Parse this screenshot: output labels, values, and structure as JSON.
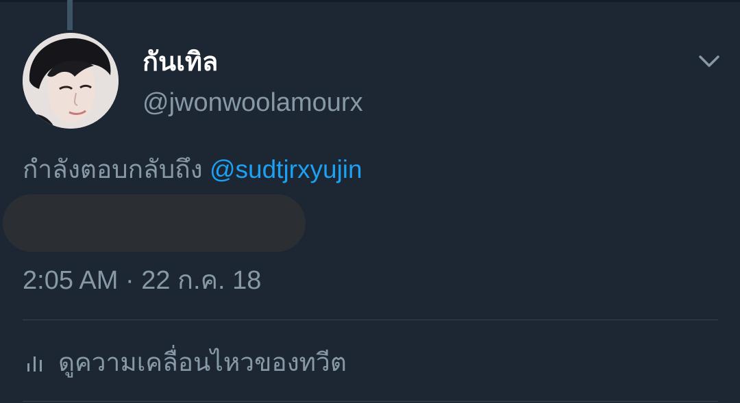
{
  "tweet": {
    "display_name": "กันเทิล",
    "handle": "@jwonwoolamourx",
    "reply_prefix": "กำลังตอบกลับถึง",
    "reply_mention": "@sudtjrxyujin",
    "timestamp": "2:05 AM · 22 ก.ค. 18"
  },
  "actions": {
    "view_activity_label": "ดูความเคลื่อนไหวของทวีต"
  },
  "icons": {
    "more": "chevron-down-icon",
    "activity": "bar-chart-icon"
  },
  "colors": {
    "background": "#1c2733",
    "text_primary": "#ffffff",
    "text_secondary": "#8899a6",
    "link": "#1da1f2",
    "divider": "#38444d",
    "redaction": "#2b2f33"
  }
}
